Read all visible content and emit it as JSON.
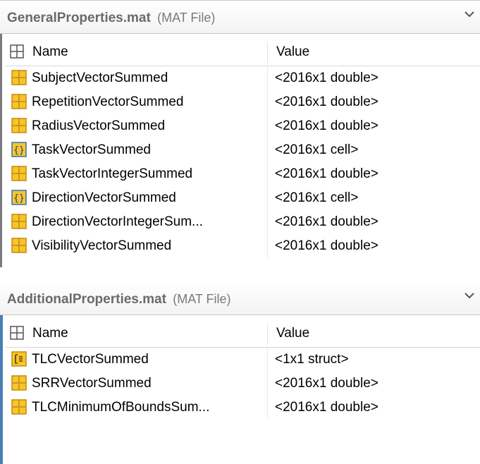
{
  "panels": [
    {
      "title": "GeneralProperties.mat",
      "subtitle": "(MAT File)",
      "columns": {
        "name": "Name",
        "value": "Value"
      },
      "rows": [
        {
          "name": "SubjectVectorSummed",
          "value": "<2016x1 double>",
          "icon": "matrix-icon"
        },
        {
          "name": "RepetitionVectorSummed",
          "value": "<2016x1 double>",
          "icon": "matrix-icon"
        },
        {
          "name": "RadiusVectorSummed",
          "value": "<2016x1 double>",
          "icon": "matrix-icon"
        },
        {
          "name": "TaskVectorSummed",
          "value": "<2016x1 cell>",
          "icon": "cell-icon"
        },
        {
          "name": "TaskVectorIntegerSummed",
          "value": "<2016x1 double>",
          "icon": "matrix-icon"
        },
        {
          "name": "DirectionVectorSummed",
          "value": "<2016x1 cell>",
          "icon": "cell-icon"
        },
        {
          "name": "DirectionVectorIntegerSum...",
          "value": "<2016x1 double>",
          "icon": "matrix-icon"
        },
        {
          "name": "VisibilityVectorSummed",
          "value": "<2016x1 double>",
          "icon": "matrix-icon"
        }
      ]
    },
    {
      "title": "AdditionalProperties.mat",
      "subtitle": "(MAT File)",
      "columns": {
        "name": "Name",
        "value": "Value"
      },
      "rows": [
        {
          "name": "TLCVectorSummed",
          "value": "<1x1 struct>",
          "icon": "struct-icon"
        },
        {
          "name": "SRRVectorSummed",
          "value": "<2016x1 double>",
          "icon": "matrix-icon"
        },
        {
          "name": "TLCMinimumOfBoundsSum...",
          "value": "<2016x1 double>",
          "icon": "matrix-icon"
        }
      ]
    }
  ],
  "colors": {
    "icon_fill": "#f7c52b",
    "icon_border": "#c48a10",
    "cell_icon_border": "#3a6fc4",
    "accent_border": "#4a7fb5"
  }
}
